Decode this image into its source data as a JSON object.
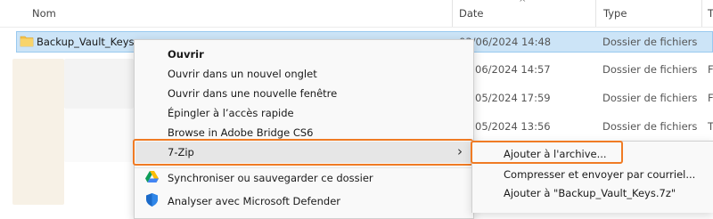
{
  "header": {
    "name_label": "Nom",
    "date_label": "Date",
    "type_label": "Type",
    "size_label_partial": "T",
    "sort_arrow": "^"
  },
  "rows": [
    {
      "name": "Backup_Vault_Keys",
      "date": "03/06/2024 14:48",
      "type": "Dossier de fichiers"
    },
    {
      "date": "06/2024 14:57",
      "type": "Dossier de fichiers"
    },
    {
      "date": "05/2024 17:59",
      "type": "Dossier de fichiers"
    },
    {
      "date": "05/2024 13:56",
      "type": "Dossier de fichiers"
    }
  ],
  "right_edge": [
    "F",
    "F",
    "T"
  ],
  "context_menu": {
    "items": [
      "Ouvrir",
      "Ouvrir dans un nouvel onglet",
      "Ouvrir dans une nouvelle fenêtre",
      "Épingler à l’accès rapide",
      "Browse in Adobe Bridge CS6",
      "7-Zip",
      "Synchroniser ou sauvegarder ce dossier",
      "Analyser avec Microsoft Defender"
    ],
    "submenu_arrow": "›"
  },
  "submenu": {
    "items": [
      "Ajouter à l'archive...",
      "Compresser et envoyer par courriel...",
      "Ajouter à \"Backup_Vault_Keys.7z\""
    ]
  },
  "colors": {
    "highlight_border": "#f07b24",
    "selection_bg": "#cce4f7",
    "folder_icon": "#f4c046"
  }
}
